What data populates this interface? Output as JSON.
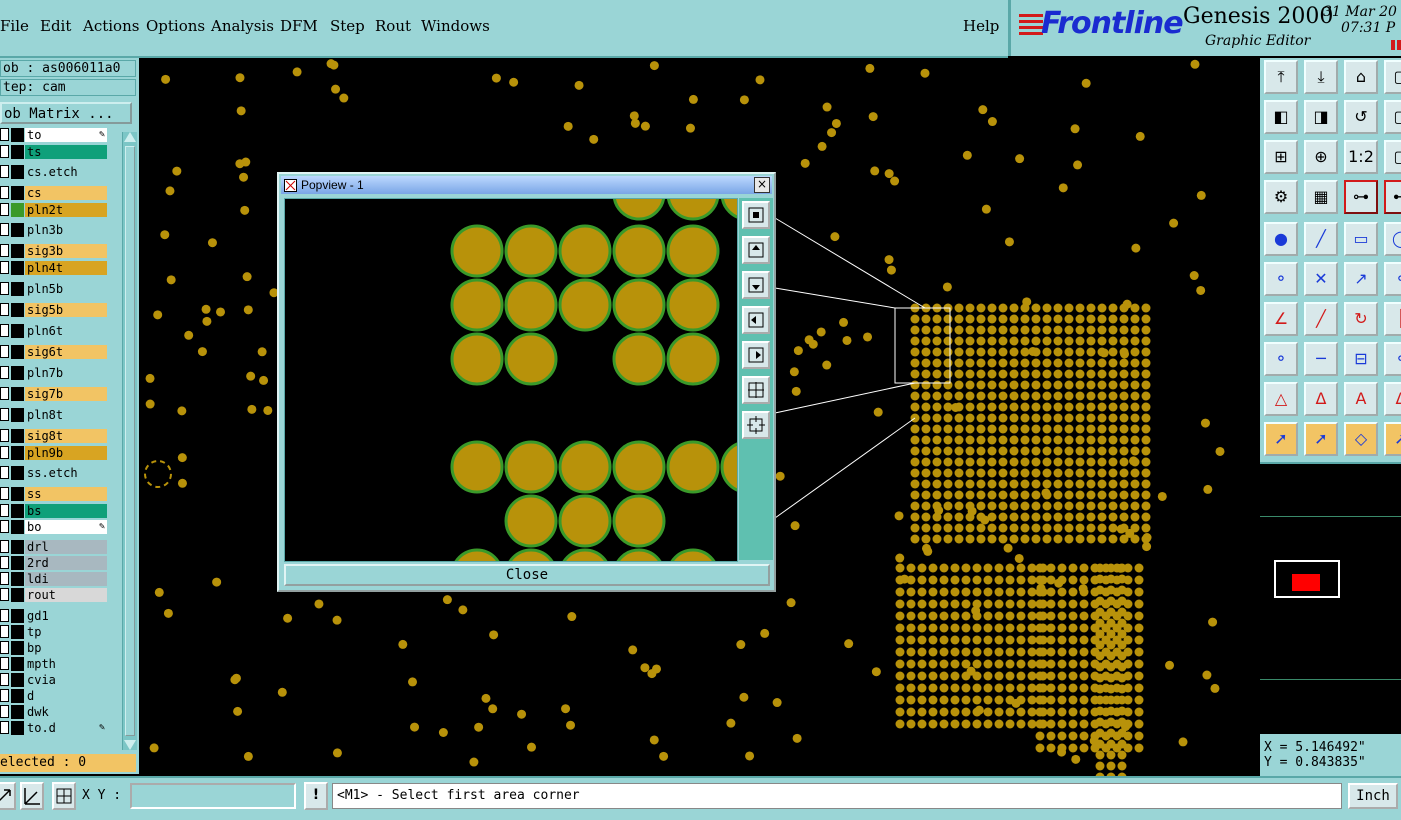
{
  "menu": {
    "items": [
      "File",
      "Edit",
      "Actions",
      "Options",
      "Analysis",
      "DFM",
      "Step",
      "Rout",
      "Windows"
    ],
    "help": "Help"
  },
  "brand": {
    "logo": "Frontline",
    "product": "Genesis 2000",
    "subtitle": "Graphic Editor",
    "date": "31 Mar 20",
    "time": "07:31 P"
  },
  "job": {
    "job_line": "ob : as006011a0",
    "step_line": "tep: cam",
    "matrix_button": "ob Matrix ..."
  },
  "layers": [
    {
      "name": "to",
      "color": "#ffffff",
      "icon": "pencil-icon"
    },
    {
      "name": "ts",
      "color": "#0fa07a"
    },
    {
      "name": "cs.etch",
      "color": "#9ad5d6"
    },
    {
      "name": "cs",
      "color": "#f2c464"
    },
    {
      "name": "pln2t",
      "color": "#d8a422"
    },
    {
      "name": "pln3b",
      "color": "#9ad5d6"
    },
    {
      "name": "sig3b",
      "color": "#f2c464"
    },
    {
      "name": "pln4t",
      "color": "#d8a422"
    },
    {
      "name": "pln5b",
      "color": "#9ad5d6"
    },
    {
      "name": "sig5b",
      "color": "#f2c464"
    },
    {
      "name": "pln6t",
      "color": "#9ad5d6"
    },
    {
      "name": "sig6t",
      "color": "#f2c464"
    },
    {
      "name": "pln7b",
      "color": "#9ad5d6"
    },
    {
      "name": "sig7b",
      "color": "#f2c464"
    },
    {
      "name": "pln8t",
      "color": "#9ad5d6"
    },
    {
      "name": "sig8t",
      "color": "#f2c464"
    },
    {
      "name": "pln9b",
      "color": "#d8a422"
    },
    {
      "name": "ss.etch",
      "color": "#9ad5d6"
    },
    {
      "name": "ss",
      "color": "#f2c464"
    },
    {
      "name": "bs",
      "color": "#0fa07a"
    },
    {
      "name": "bo",
      "color": "#ffffff",
      "icon": "pencil-icon"
    },
    {
      "name": "drl",
      "color": "#a8b8c0"
    },
    {
      "name": "2rd",
      "color": "#a8b8c0"
    },
    {
      "name": "ldi",
      "color": "#a8b8c0"
    },
    {
      "name": "rout",
      "color": "#d8d8d8"
    },
    {
      "name": "gd1",
      "color": "#9ad5d6"
    },
    {
      "name": "tp",
      "color": "#9ad5d6"
    },
    {
      "name": "bp",
      "color": "#9ad5d6"
    },
    {
      "name": "mpth",
      "color": "#9ad5d6"
    },
    {
      "name": "cvia",
      "color": "#9ad5d6"
    },
    {
      "name": "d",
      "color": "#9ad5d6"
    },
    {
      "name": "dwk",
      "color": "#9ad5d6"
    },
    {
      "name": "to.d",
      "color": "#9ad5d6",
      "icon": "pencil-icon"
    }
  ],
  "selected_text": "elected : 0",
  "popview": {
    "title": "Popview - 1",
    "close_button": "Close",
    "close_x": "×"
  },
  "coords": {
    "x_line": "X = 5.146492\"",
    "y_line": "Y = 0.843835\""
  },
  "status": {
    "xy_label": "X Y :",
    "xy_value": "",
    "warn": "!",
    "message": "<M1> - Select first area corner",
    "units": "Inch"
  },
  "colors": {
    "panel": "#9ad5d6",
    "pad": "#b8920a",
    "pad_outline": "#3a9a2a",
    "canvas": "#000000"
  }
}
